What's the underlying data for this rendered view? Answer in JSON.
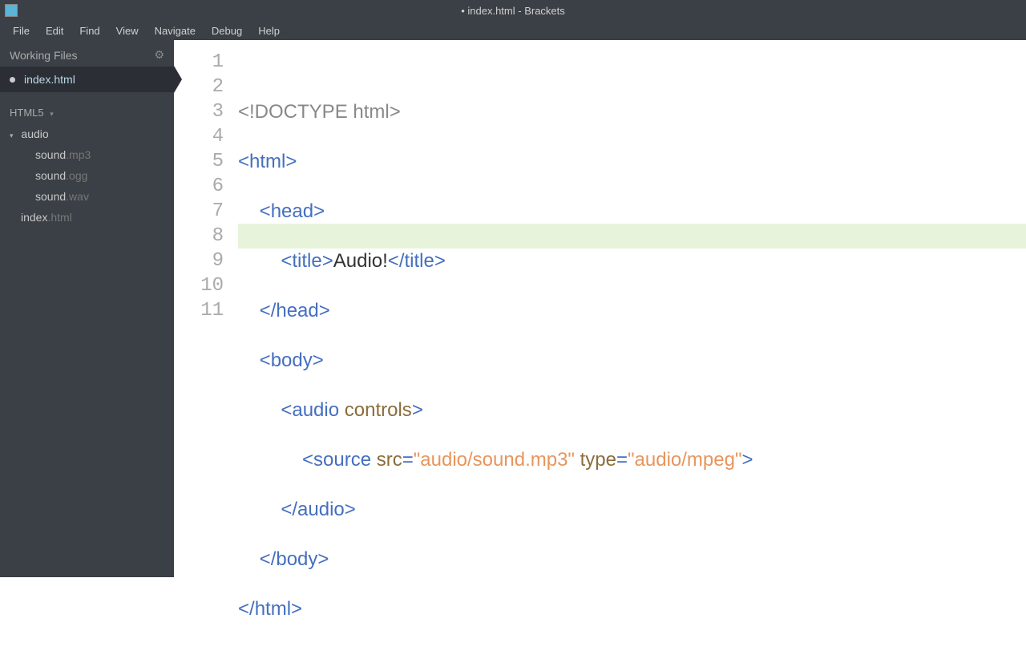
{
  "titlebar": {
    "text": "• index.html - Brackets"
  },
  "menu": {
    "file": "File",
    "edit": "Edit",
    "find": "Find",
    "view": "View",
    "navigate": "Navigate",
    "debug": "Debug",
    "help": "Help"
  },
  "sidebar": {
    "workingHeader": "Working Files",
    "workingFile": "index.html",
    "fileType": "HTML5",
    "tree": {
      "folder": "audio",
      "files": [
        {
          "base": "sound",
          "ext": ".mp3"
        },
        {
          "base": "sound",
          "ext": ".ogg"
        },
        {
          "base": "sound",
          "ext": ".wav"
        }
      ],
      "rootFile": {
        "base": "index",
        "ext": ".html"
      }
    }
  },
  "editor": {
    "lineNumbers": [
      "1",
      "2",
      "3",
      "4",
      "5",
      "6",
      "7",
      "8",
      "9",
      "10",
      "11"
    ],
    "tokens": {
      "doctype": "<!DOCTYPE html>",
      "htmlOpen_lt": "<",
      "htmlOpen_tag": "html",
      "htmlOpen_gt": ">",
      "headOpen_lt": "<",
      "headOpen_tag": "head",
      "headOpen_gt": ">",
      "titleOpen_lt": "<",
      "titleOpen_tag": "title",
      "titleOpen_gt": ">",
      "titleText": "Audio!",
      "titleClose_lt": "</",
      "titleClose_tag": "title",
      "titleClose_gt": ">",
      "headClose_lt": "</",
      "headClose_tag": "head",
      "headClose_gt": ">",
      "bodyOpen_lt": "<",
      "bodyOpen_tag": "body",
      "bodyOpen_gt": ">",
      "audioOpen_lt": "<",
      "audioOpen_tag": "audio",
      "audioAttr": "controls",
      "audioOpen_gt": ">",
      "sourceOpen_lt": "<",
      "sourceOpen_tag": "source",
      "srcAttr": "src",
      "srcEq": "=",
      "srcVal": "\"audio/sound.mp3\"",
      "typeAttr": "type",
      "typeEq": "=",
      "typeVal": "\"audio/mpeg\"",
      "sourceOpen_gt": ">",
      "audioClose_lt": "</",
      "audioClose_tag": "audio",
      "audioClose_gt": ">",
      "bodyClose_lt": "</",
      "bodyClose_tag": "body",
      "bodyClose_gt": ">",
      "htmlClose_lt": "</",
      "htmlClose_tag": "html",
      "htmlClose_gt": ">"
    }
  }
}
